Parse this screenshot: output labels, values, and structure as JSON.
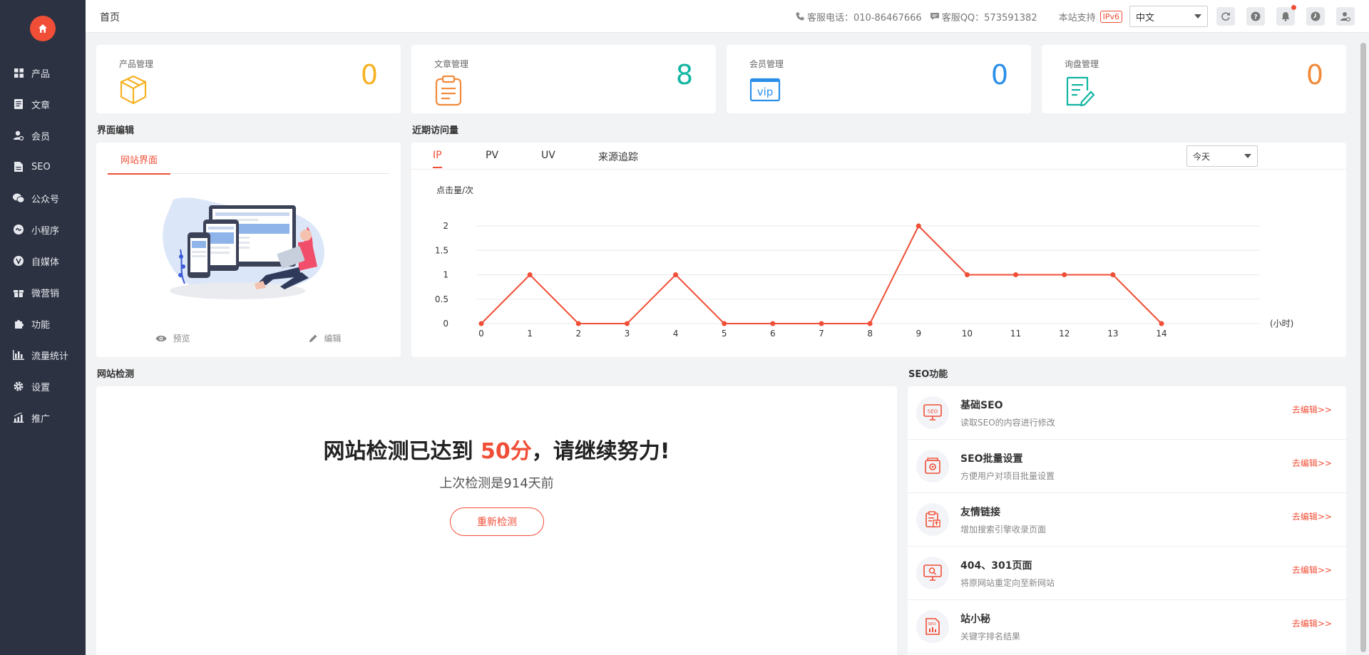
{
  "topbar": {
    "title": "首页",
    "phone_text": "客服电话：010-86467666",
    "qq_text": "客服QQ：573591382",
    "support_text": "本站支持",
    "ipv6": "IPv6",
    "language": "中文"
  },
  "sidebar": {
    "items": [
      {
        "label": "产品",
        "icon": "grid-icon"
      },
      {
        "label": "文章",
        "icon": "document-icon"
      },
      {
        "label": "会员",
        "icon": "user-icon"
      },
      {
        "label": "SEO",
        "icon": "file-icon"
      },
      {
        "label": "公众号",
        "icon": "wechat-icon"
      },
      {
        "label": "小程序",
        "icon": "miniprogram-icon"
      },
      {
        "label": "自媒体",
        "icon": "media-icon"
      },
      {
        "label": "微营销",
        "icon": "gift-icon"
      },
      {
        "label": "功能",
        "icon": "puzzle-icon"
      },
      {
        "label": "流量统计",
        "icon": "bar-chart-icon"
      },
      {
        "label": "设置",
        "icon": "gear-icon"
      },
      {
        "label": "推广",
        "icon": "trend-icon"
      }
    ]
  },
  "stats": [
    {
      "label": "产品管理",
      "value": "0",
      "color": "#f6b223"
    },
    {
      "label": "文章管理",
      "value": "8",
      "color": "#13b5a3"
    },
    {
      "label": "会员管理",
      "value": "0",
      "color": "#2a8fe8"
    },
    {
      "label": "询盘管理",
      "value": "0",
      "color": "#f18a3a"
    }
  ],
  "interface_edit": {
    "title": "界面编辑",
    "tab": "网站界面",
    "preview_label": "预览",
    "edit_label": "编辑"
  },
  "visits": {
    "title": "近期访问量",
    "tabs": [
      "IP",
      "PV",
      "UV",
      "来源追踪"
    ],
    "active_tab": "IP",
    "period": "今天"
  },
  "chart_data": {
    "type": "line",
    "ylabel": "点击量/次",
    "xlabel": "(小时)",
    "x": [
      0,
      1,
      2,
      3,
      4,
      5,
      6,
      7,
      8,
      9,
      10,
      11,
      12,
      13,
      14
    ],
    "values": [
      0,
      1,
      0,
      0,
      1,
      0,
      0,
      0,
      0,
      2,
      1,
      1,
      1,
      1,
      0
    ],
    "yticks": [
      "0",
      "0.5",
      "1",
      "1.5",
      "2"
    ],
    "ylim": [
      0,
      2
    ],
    "grid": true,
    "color": "#f04e37"
  },
  "site_check": {
    "title": "网站检测",
    "headline_prefix": "网站检测已达到",
    "score": "50分",
    "headline_suffix": "，请继续努力!",
    "subtitle": "上次检测是914天前",
    "button": "重新检测"
  },
  "seo": {
    "title": "SEO功能",
    "items": [
      {
        "name": "基础SEO",
        "desc": "读取SEO的内容进行修改",
        "link": "去编辑>>"
      },
      {
        "name": "SEO批量设置",
        "desc": "方便用户对项目批量设置",
        "link": "去编辑>>"
      },
      {
        "name": "友情链接",
        "desc": "增加搜索引擎收录页面",
        "link": "去编辑>>"
      },
      {
        "name": "404、301页面",
        "desc": "将原网站重定向至新网站",
        "link": "去编辑>>"
      },
      {
        "name": "站小秘",
        "desc": "关键字排名结果",
        "link": "去编辑>>"
      }
    ]
  }
}
